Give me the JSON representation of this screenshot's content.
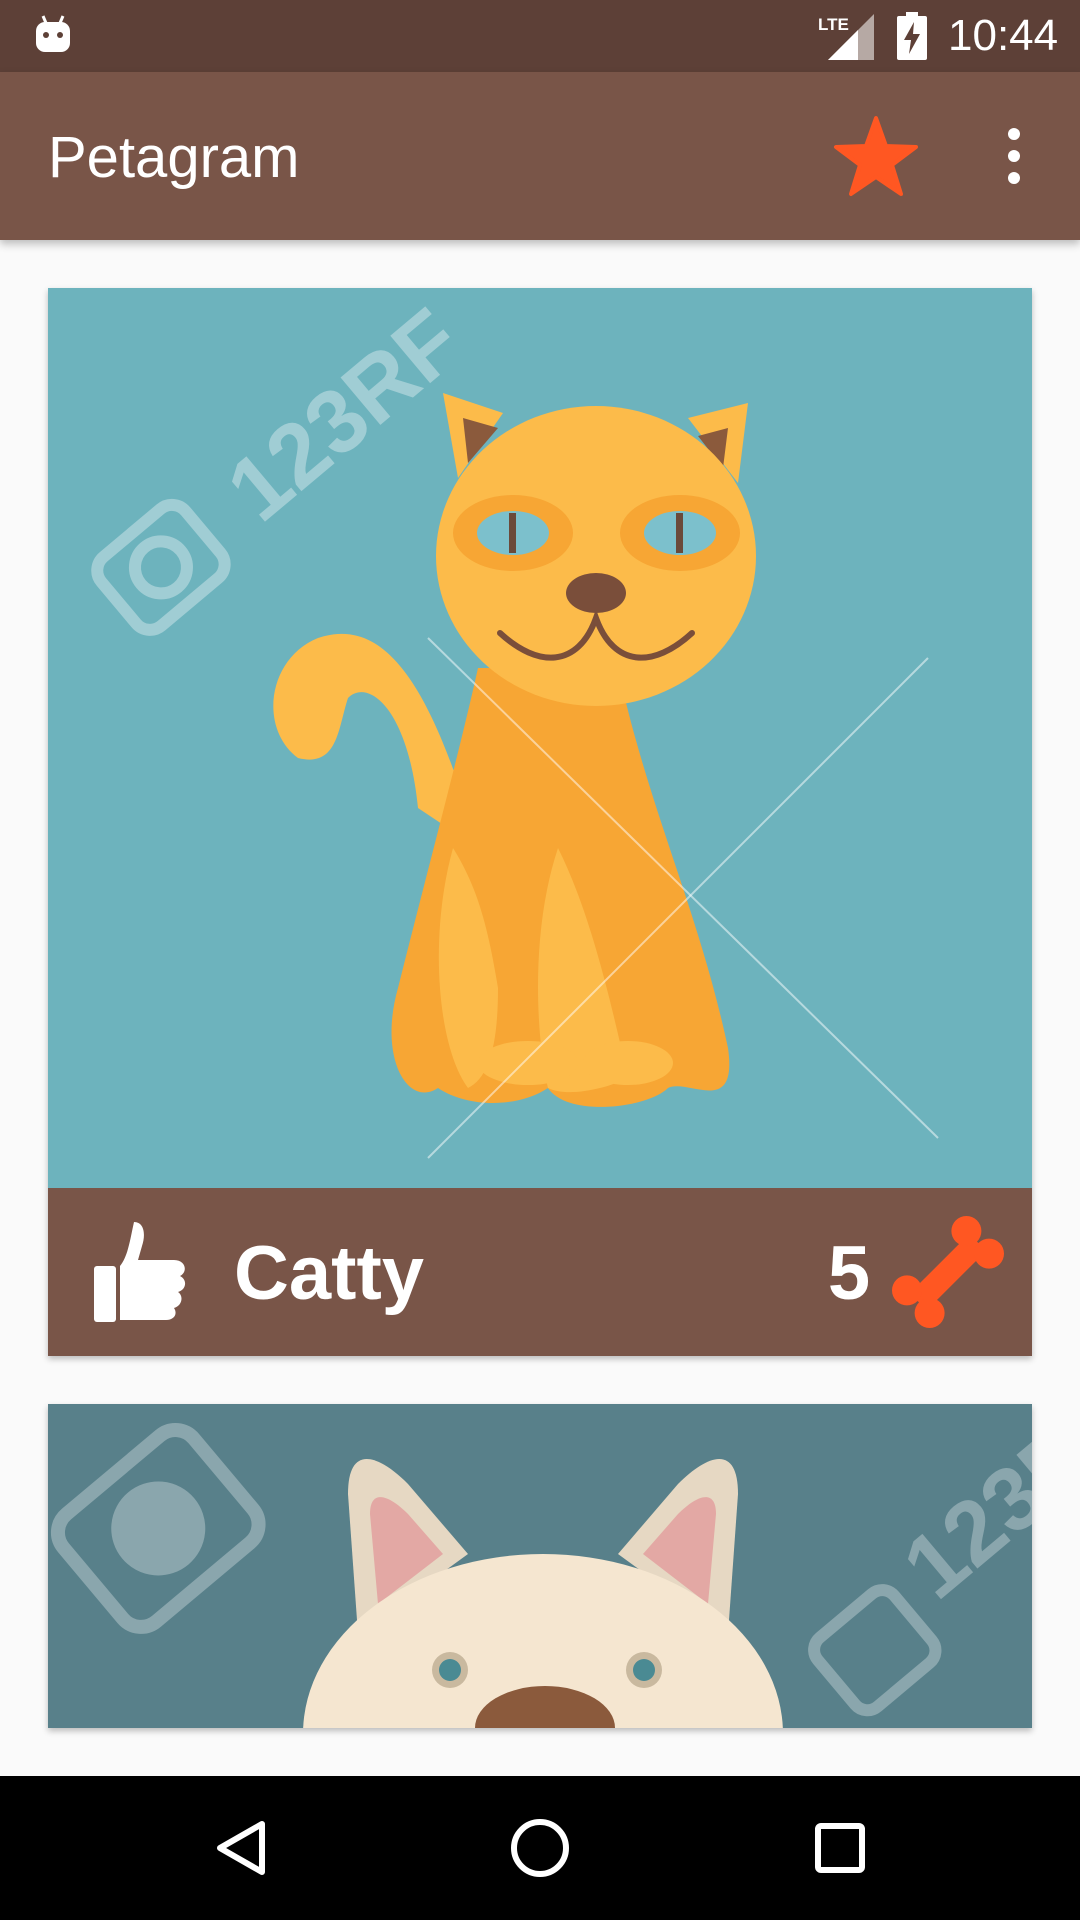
{
  "status_bar": {
    "time": "10:44",
    "network": "LTE",
    "icons": [
      "android-icon",
      "lte-signal-icon",
      "battery-charging-icon"
    ]
  },
  "app_bar": {
    "title": "Petagram",
    "actions": [
      {
        "name": "favorites",
        "icon": "star-icon"
      },
      {
        "name": "more",
        "icon": "overflow-menu-icon"
      }
    ]
  },
  "pets": [
    {
      "name": "Catty",
      "likes": "5",
      "photo": "cartoon orange cat on teal background",
      "like_icon": "thumbs-up-icon",
      "rating_icon": "bone-icon"
    },
    {
      "name": "",
      "likes": "",
      "photo": "cartoon white dog on dark teal background"
    }
  ],
  "colors": {
    "primary": "#795548",
    "primary_dark": "#5D4037",
    "accent": "#FF5722",
    "background": "#FAFAFA"
  },
  "nav_bar": {
    "buttons": [
      "back",
      "home",
      "recents"
    ]
  }
}
